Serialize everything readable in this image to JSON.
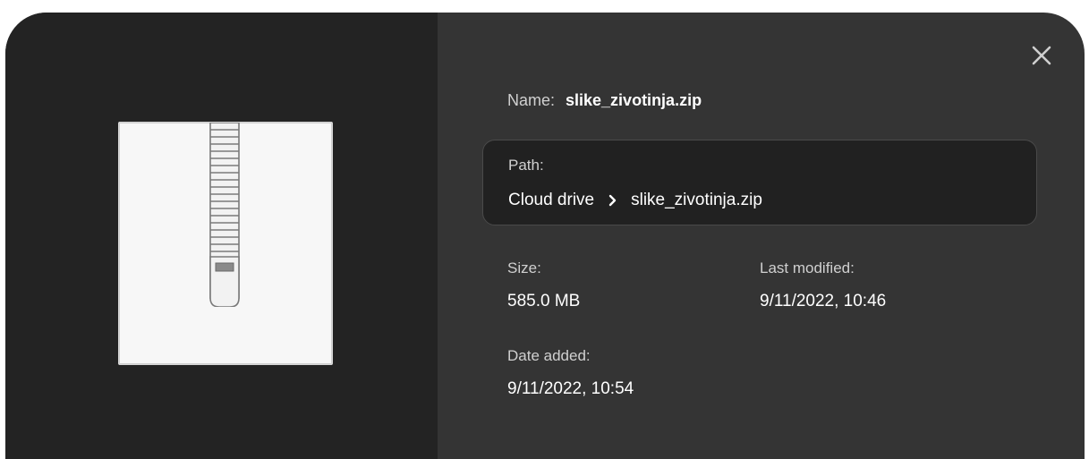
{
  "file": {
    "name_label": "Name:",
    "name": "slike_zivotinja.zip",
    "icon": "zip-archive-icon"
  },
  "path": {
    "label": "Path:",
    "crumbs": [
      "Cloud drive",
      "slike_zivotinja.zip"
    ],
    "separator_icon": "chevron-right-icon"
  },
  "details": {
    "size_label": "Size:",
    "size_value": "585.0 MB",
    "modified_label": "Last modified:",
    "modified_value": "9/11/2022, 10:46",
    "added_label": "Date added:",
    "added_value": "9/11/2022, 10:54"
  },
  "close_icon": "close-icon",
  "colors": {
    "dialog_bg": "#343434",
    "preview_bg": "#232323",
    "path_box_bg": "#212121",
    "text": "#ffffff",
    "label_text": "#d0d0d0"
  }
}
